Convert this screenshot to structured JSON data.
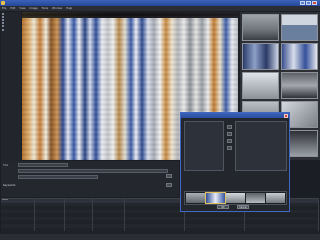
{
  "window": {
    "title": ""
  },
  "menubar": {
    "items": [
      "File",
      "Edit",
      "View",
      "Image",
      "Tools",
      "Window",
      "Help"
    ]
  },
  "tree": {
    "items": [
      "",
      "",
      "",
      "",
      "",
      ""
    ]
  },
  "thumbnails": [
    "t1",
    "t2",
    "t3",
    "t4",
    "t5",
    "t6",
    "t7",
    "t8",
    "t9",
    "t10"
  ],
  "meta": {
    "fields": [
      {
        "label": "Title",
        "value": ""
      },
      {
        "label": "",
        "value": ""
      },
      {
        "label": "",
        "value": ""
      }
    ],
    "keywords_label": "Keywords"
  },
  "table": {
    "headers": [
      "Name",
      "",
      "",
      "",
      "",
      "",
      ""
    ],
    "rows": [
      [
        "",
        "",
        "",
        "",
        "",
        "",
        ""
      ],
      [
        "",
        "",
        "",
        "",
        "",
        "",
        ""
      ],
      [
        "",
        "",
        "",
        "",
        "",
        "",
        ""
      ],
      [
        "",
        "",
        "",
        "",
        "",
        "",
        ""
      ],
      [
        "",
        "",
        "",
        "",
        "",
        "",
        ""
      ],
      [
        "",
        "",
        "",
        "",
        "",
        "",
        ""
      ],
      [
        "",
        "",
        "",
        "",
        "",
        "",
        ""
      ],
      [
        "",
        "",
        "",
        "",
        "",
        "",
        ""
      ]
    ]
  },
  "status": {
    "left": "",
    "right": ""
  },
  "dialog": {
    "title": "",
    "left_list": [
      "",
      "",
      "",
      "",
      "",
      "",
      "",
      "",
      ""
    ],
    "ok_label": "OK",
    "cancel_label": "Cancel"
  },
  "colors": {
    "accent": "#3b63b8",
    "panel": "#23262d",
    "background": "#1b1e24"
  }
}
